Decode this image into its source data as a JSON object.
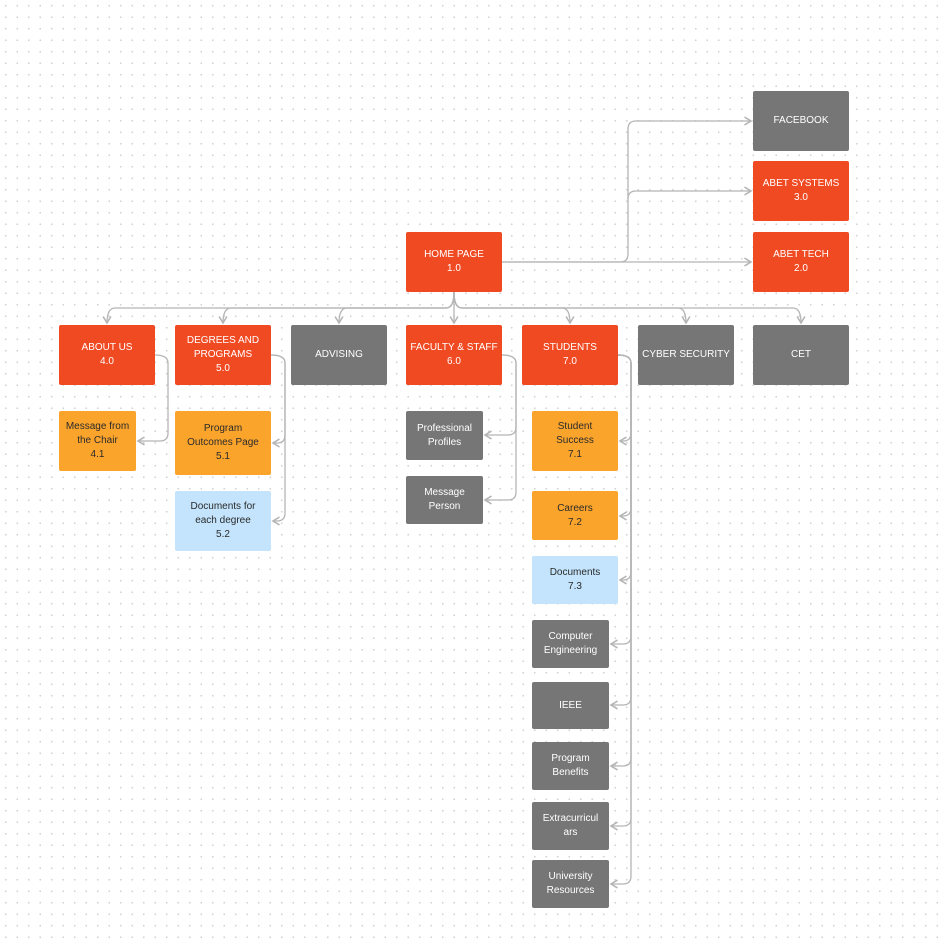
{
  "colors": {
    "primary": "#f04a23",
    "external": "#767676",
    "subpage": "#fba42c",
    "document": "#c3e4fc",
    "connector": "#b5b5b5"
  },
  "nodes": [
    {
      "id": "facebook",
      "label": "FACEBOOK",
      "style": "grey"
    },
    {
      "id": "abet-systems",
      "label": "ABET SYSTEMS\n3.0",
      "style": "red"
    },
    {
      "id": "abet-tech",
      "label": "ABET TECH\n2.0",
      "style": "red"
    },
    {
      "id": "home",
      "label": "HOME PAGE\n1.0",
      "style": "red"
    },
    {
      "id": "about",
      "label": "ABOUT US\n4.0",
      "style": "red"
    },
    {
      "id": "degrees",
      "label": "DEGREES AND\nPROGRAMS\n5.0",
      "style": "red"
    },
    {
      "id": "advising",
      "label": "ADVISING",
      "style": "grey"
    },
    {
      "id": "faculty",
      "label": "FACULTY & STAFF\n6.0",
      "style": "red"
    },
    {
      "id": "students",
      "label": "STUDENTS\n7.0",
      "style": "red"
    },
    {
      "id": "cyber",
      "label": "CYBER SECURITY",
      "style": "grey"
    },
    {
      "id": "cet",
      "label": "CET",
      "style": "grey"
    },
    {
      "id": "chair",
      "label": "Message from\nthe Chair\n4.1",
      "style": "amber"
    },
    {
      "id": "outcomes",
      "label": "Program\nOutcomes Page\n5.1",
      "style": "amber"
    },
    {
      "id": "degree-docs",
      "label": "Documents for\neach degree\n5.2",
      "style": "blue"
    },
    {
      "id": "profiles",
      "label": "Professional\nProfiles",
      "style": "grey"
    },
    {
      "id": "message-person",
      "label": "Message\nPerson",
      "style": "grey"
    },
    {
      "id": "success",
      "label": "Student\nSuccess\n7.1",
      "style": "amber"
    },
    {
      "id": "careers",
      "label": "Careers\n7.2",
      "style": "amber"
    },
    {
      "id": "documents",
      "label": "Documents\n7.3",
      "style": "blue"
    },
    {
      "id": "comp-eng",
      "label": "Computer\nEngineering",
      "style": "grey"
    },
    {
      "id": "ieee",
      "label": "IEEE",
      "style": "grey"
    },
    {
      "id": "benefits",
      "label": "Program\nBenefits",
      "style": "grey"
    },
    {
      "id": "extra",
      "label": "Extracurricul\nars",
      "style": "grey"
    },
    {
      "id": "resources",
      "label": "University\nResources",
      "style": "grey"
    }
  ]
}
